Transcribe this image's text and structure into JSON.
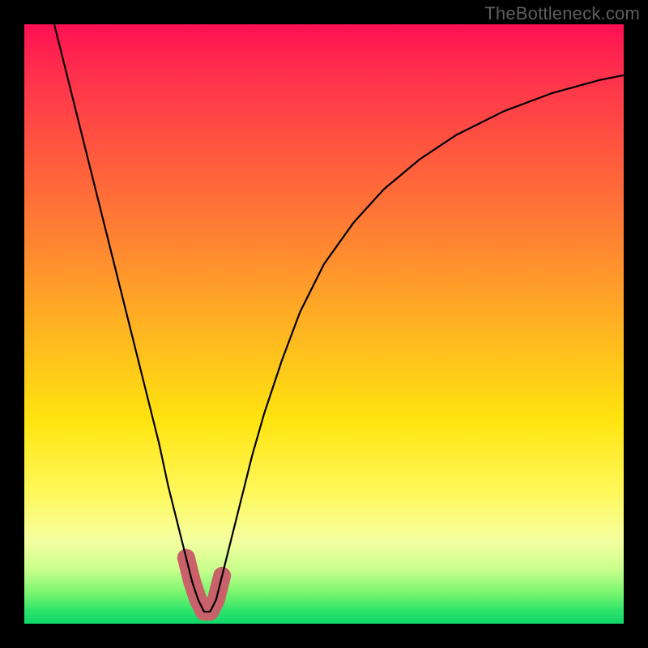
{
  "watermark": "TheBottleneck.com",
  "colors": {
    "frame": "#000000",
    "curve": "#000000",
    "highlight": "#c9616a",
    "gradient_top": "#ff1053",
    "gradient_bottom": "#0fd66a"
  },
  "chart_data": {
    "type": "line",
    "title": "",
    "xlabel": "",
    "ylabel": "",
    "xlim": [
      0,
      100
    ],
    "ylim": [
      0,
      100
    ],
    "grid": false,
    "legend": false,
    "series": [
      {
        "name": "curve",
        "x": [
          5,
          7.5,
          10,
          12.5,
          15,
          17.5,
          20,
          22.5,
          24,
          25.5,
          27,
          28,
          29,
          30,
          31,
          32,
          33,
          34.5,
          36,
          38,
          40,
          43,
          46,
          50,
          55,
          60,
          66,
          72,
          80,
          88,
          96,
          100
        ],
        "y": [
          100,
          90,
          80,
          70,
          60,
          50,
          40,
          30,
          23,
          17,
          11,
          7,
          4,
          2,
          2,
          4,
          8,
          14,
          20,
          28,
          35,
          44,
          52,
          60,
          67,
          72.5,
          77.5,
          81.5,
          85.5,
          88.5,
          90.7,
          91.5
        ]
      },
      {
        "name": "highlight",
        "x": [
          27,
          28,
          29,
          30,
          31,
          32,
          33
        ],
        "y": [
          11,
          7,
          4,
          2,
          2,
          4,
          8
        ]
      }
    ],
    "notes": "Values estimated from pixel positions against the 0–100 normalized plot area; the curve minimum is near x≈30. No axis ticks or labels are visible."
  }
}
